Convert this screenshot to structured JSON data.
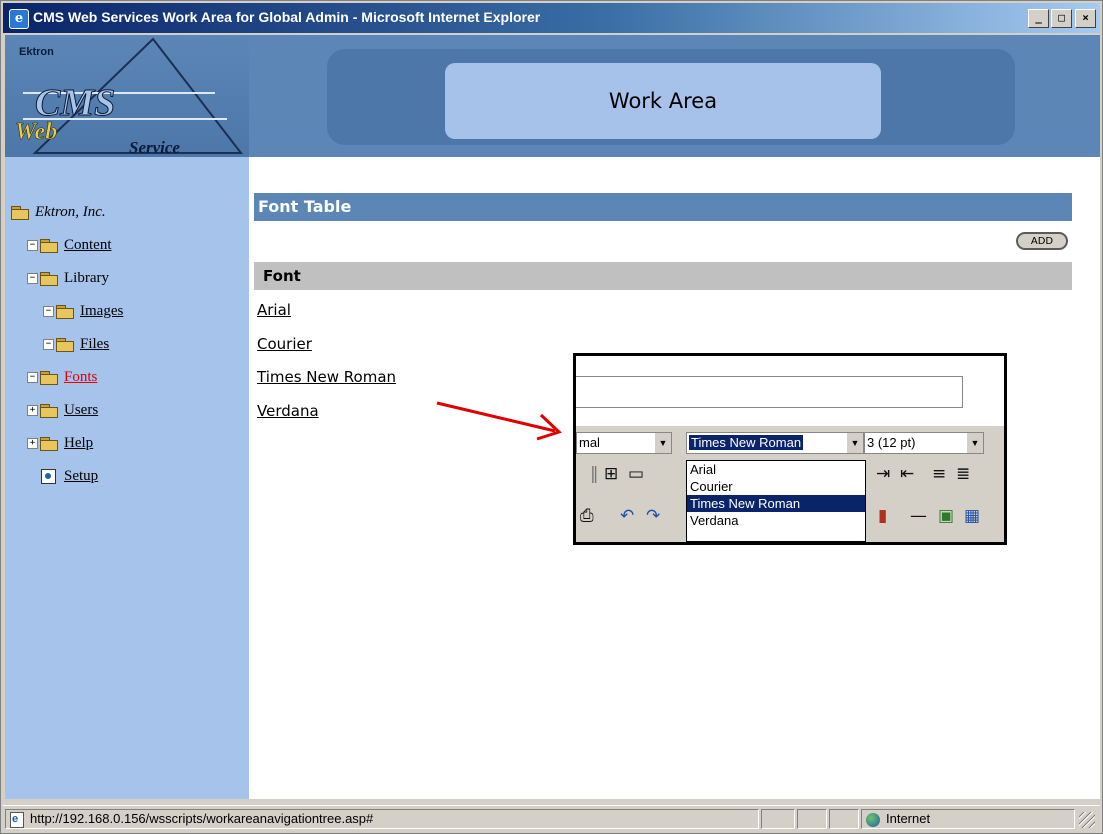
{
  "window": {
    "title": "CMS Web Services Work Area for Global Admin - Microsoft Internet Explorer",
    "controls": {
      "minimize": "_",
      "maximize": "□",
      "close": "×"
    }
  },
  "logo": {
    "company": "Ektron",
    "line1": "CMS",
    "line2": "Web",
    "line3": "Service"
  },
  "header": {
    "title": "Work Area"
  },
  "tree": {
    "root": "Ektron, Inc.",
    "items": [
      {
        "label": "Content"
      },
      {
        "label": "Library"
      },
      {
        "label": "Images"
      },
      {
        "label": "Files"
      },
      {
        "label": "Fonts"
      },
      {
        "label": "Users"
      },
      {
        "label": "Help"
      },
      {
        "label": "Setup"
      }
    ]
  },
  "main": {
    "section_title": "Font Table",
    "add_label": "ADD",
    "column_header": "Font",
    "fonts": [
      "Arial",
      "Courier",
      "Times New Roman",
      "Verdana"
    ]
  },
  "callout": {
    "style_select": "mal",
    "font_select": "Times New Roman",
    "size_select": "3 (12 pt)",
    "dropdown_options": [
      "Arial",
      "Courier",
      "Times New Roman",
      "Verdana"
    ],
    "dropdown_selected": "Times New Roman",
    "arrow_color": "#e00000"
  },
  "status": {
    "url": "http://192.168.0.156/wsscripts/workareanavigationtree.asp#",
    "zone": "Internet"
  }
}
